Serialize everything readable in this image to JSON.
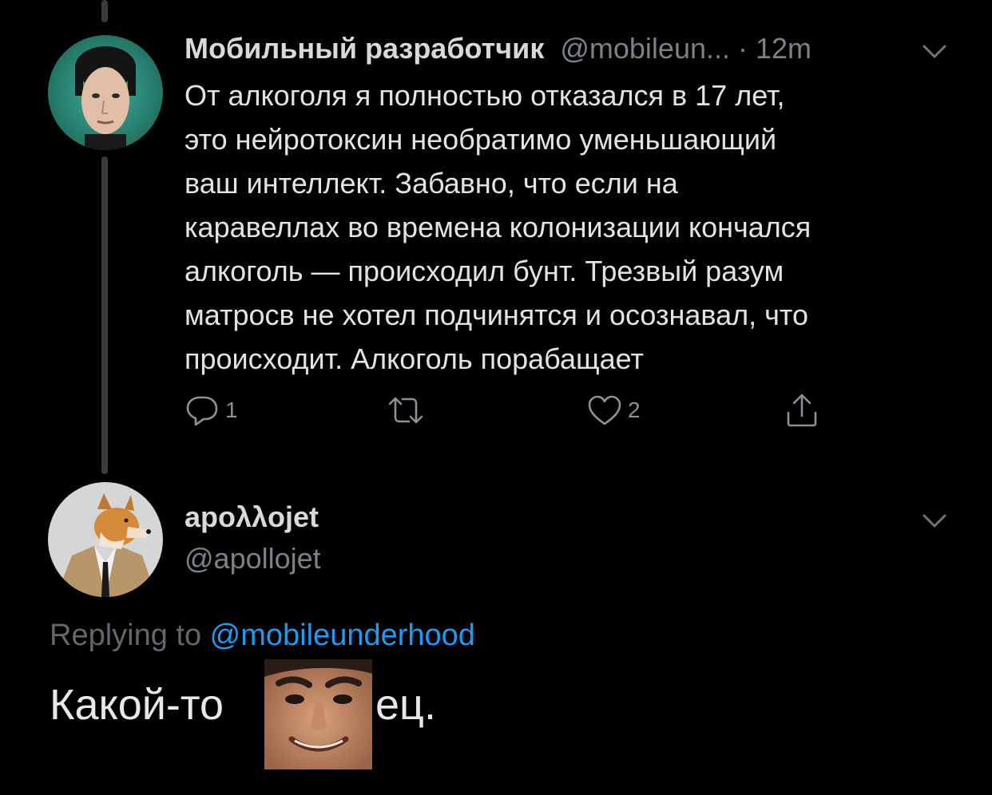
{
  "tweet1": {
    "author_name": "Мобильный разработчик",
    "author_meta": "@mobileun... · 12m",
    "text_lines": [
      "От алкоголя я полностью отказался в 17 лет,",
      "это нейротоксин необратимо уменьшающий",
      "ваш интеллект. Забавно, что если на",
      "каравеллах во времена колонизации кончался",
      "алкоголь — происходил бунт. Трезвый разум",
      "матросв не хотел подчинятся и осознавал, что",
      "происходит. Алкоголь порабащает"
    ],
    "actions": {
      "reply_count": "1",
      "retweet_count": "",
      "like_count": "2"
    }
  },
  "tweet2": {
    "author_name": "apoλλojet",
    "author_handle": "@apollojet",
    "replying_prefix": "Replying to ",
    "replying_mention": "@mobileunderhood",
    "text_part1": "Какой-то",
    "text_part2": "ец."
  },
  "colors": {
    "background": "#000000",
    "primary_text": "#e1e4e6",
    "secondary_text": "#7b8287",
    "accent": "#1d9bf0"
  },
  "icons": [
    "reply-icon",
    "retweet-icon",
    "like-icon",
    "share-icon",
    "chevron-down-icon"
  ]
}
